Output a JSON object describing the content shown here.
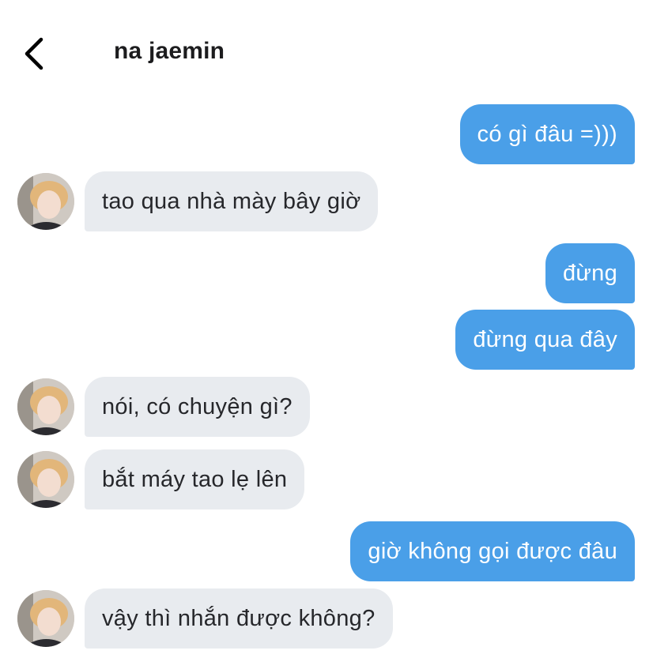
{
  "header": {
    "back_icon": "chevron-left-icon",
    "title": "na jaemin"
  },
  "messages": [
    {
      "side": "out",
      "text": "có gì đâu =)))"
    },
    {
      "side": "in",
      "text": "tao qua nhà mày bây giờ"
    },
    {
      "side": "out",
      "text": "đừng"
    },
    {
      "side": "out",
      "text": "đừng qua đây"
    },
    {
      "side": "in",
      "text": "nói, có chuyện gì?"
    },
    {
      "side": "in",
      "text": "bắt máy tao lẹ lên"
    },
    {
      "side": "out",
      "text": "giờ không gọi được đâu"
    },
    {
      "side": "in",
      "text": "vậy thì nhắn được không?"
    }
  ],
  "colors": {
    "outgoing_bubble": "#4a9fe8",
    "incoming_bubble": "#e8ebef",
    "title_text": "#1c1c1e"
  }
}
